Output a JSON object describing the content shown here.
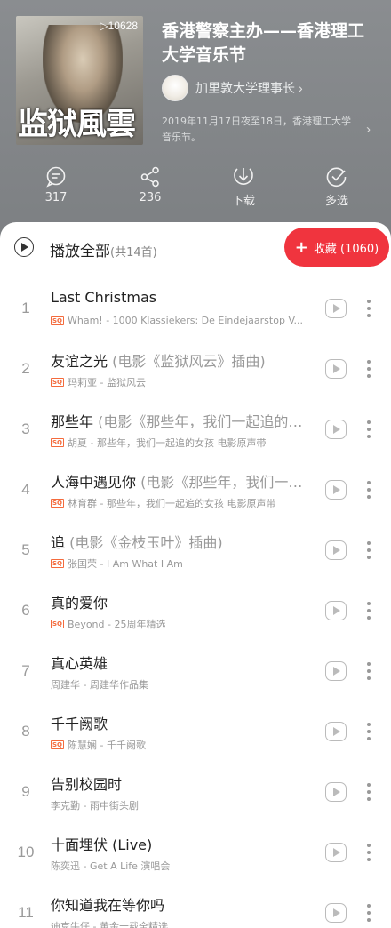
{
  "playlist": {
    "cover_playcount": "▷10628",
    "cover_title": "监狱風雲",
    "title": "香港警察主办——香港理工大学音乐节",
    "creator": "加里敦大学理事长",
    "description": "2019年11月17日夜至18日，香港理工大学音乐节。"
  },
  "actions": [
    {
      "icon": "comment-icon",
      "label": "317"
    },
    {
      "icon": "share-icon",
      "label": "236"
    },
    {
      "icon": "download-icon",
      "label": "下载"
    },
    {
      "icon": "multi-select-icon",
      "label": "多选"
    }
  ],
  "play_all": {
    "label": "播放全部",
    "count": "(共14首)"
  },
  "collect": {
    "plus": "+",
    "label": "收藏 (1060)"
  },
  "tag_label": "SQ",
  "songs": [
    {
      "index": "1",
      "title": "Last Christmas",
      "subtitle": "",
      "sq": true,
      "meta": "Wham! - 1000 Klassiekers: De Eindejaarstop V..."
    },
    {
      "index": "2",
      "title": "友谊之光",
      "subtitle": " (电影《监狱风云》插曲)",
      "sq": true,
      "meta": "玛莉亚 - 监狱风云"
    },
    {
      "index": "3",
      "title": "那些年",
      "subtitle": " (电影《那些年，我们一起追的…",
      "sq": true,
      "meta": "胡夏 - 那些年，我们一起追的女孩 电影原声带"
    },
    {
      "index": "4",
      "title": "人海中遇见你",
      "subtitle": " (电影《那些年，我们一…",
      "sq": true,
      "meta": "林育群 - 那些年，我们一起追的女孩 电影原声带"
    },
    {
      "index": "5",
      "title": "追",
      "subtitle": " (电影《金枝玉叶》插曲)",
      "sq": true,
      "meta": "张国荣 - I Am What I Am"
    },
    {
      "index": "6",
      "title": "真的爱你",
      "subtitle": "",
      "sq": true,
      "meta": "Beyond - 25周年精选"
    },
    {
      "index": "7",
      "title": "真心英雄",
      "subtitle": "",
      "sq": false,
      "meta": "周建华 - 周建华作品集"
    },
    {
      "index": "8",
      "title": "千千阙歌",
      "subtitle": "",
      "sq": true,
      "meta": "陈慧娴 - 千千阙歌"
    },
    {
      "index": "9",
      "title": "告别校园时",
      "subtitle": "",
      "sq": false,
      "meta": "李克勤 - 雨中街头剧"
    },
    {
      "index": "10",
      "title": "十面埋伏 (Live)",
      "subtitle": "",
      "sq": false,
      "meta": "陈奕迅 - Get A Life 演唱会"
    },
    {
      "index": "11",
      "title": "你知道我在等你吗",
      "subtitle": "",
      "sq": false,
      "meta": "迪克牛仔 - 黄金十载全精选"
    }
  ]
}
